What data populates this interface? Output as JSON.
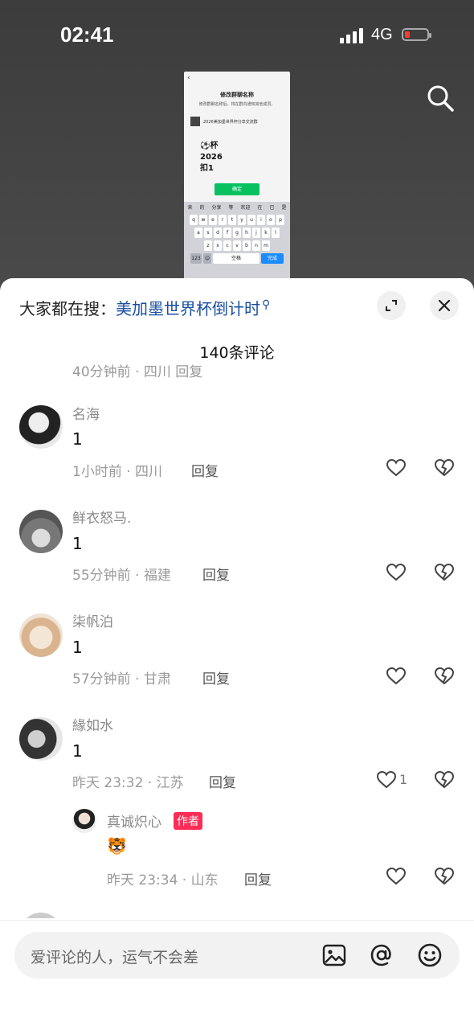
{
  "status_bar": {
    "time": "02:41",
    "network": "4G"
  },
  "video_preview": {
    "title": "修改群聊名称",
    "subtitle": "修改群聊名称后，将在群内通知其他成员。",
    "group_name": "2026美加墨世界杯分享交流群",
    "poster_text": [
      "⚽杯",
      "2026",
      "扣1"
    ],
    "confirm_label": "确定",
    "keyboard_suggestions": [
      "来",
      "的",
      "分享",
      "等",
      "欢迎",
      "在",
      "已",
      "是"
    ],
    "keyboard_rows": [
      [
        "q",
        "w",
        "e",
        "r",
        "t",
        "y",
        "u",
        "i",
        "o",
        "p"
      ],
      [
        "a",
        "s",
        "d",
        "f",
        "g",
        "h",
        "j",
        "k",
        "l"
      ],
      [
        "z",
        "x",
        "c",
        "v",
        "b",
        "n",
        "m"
      ]
    ],
    "space_label": "空格",
    "done_label": "完成",
    "num_label": "123"
  },
  "panel": {
    "hot_search_prefix": "大家都在搜：",
    "hot_search_keyword": "美加墨世界杯倒计时",
    "comment_count": "140条评论"
  },
  "comments": [
    {
      "user": "名海",
      "text": "1",
      "meta": "1小时前 · 四川",
      "reply_label": "回复"
    },
    {
      "user": "鲜衣怒马.",
      "text": "1",
      "meta": "55分钟前 · 福建",
      "reply_label": "回复"
    },
    {
      "user": "柒帆泊",
      "text": "1",
      "meta": "57分钟前 · 甘肃",
      "reply_label": "回复"
    },
    {
      "user": "緣如水",
      "text": "1",
      "meta": "昨天 23:32 · 江苏",
      "reply_label": "回复",
      "likes": "1"
    }
  ],
  "reply": {
    "user": "真诚炽心",
    "badge": "作者",
    "text": "🐯",
    "meta": "昨天 23:34 · 山东",
    "reply_label": "回复"
  },
  "ghost_row": "40分钟前 · 四川  回复",
  "input_bar": {
    "placeholder": "爱评论的人，运气不会差"
  },
  "colors": {
    "accent": "#ff2c55",
    "link": "#1a4fa0"
  }
}
